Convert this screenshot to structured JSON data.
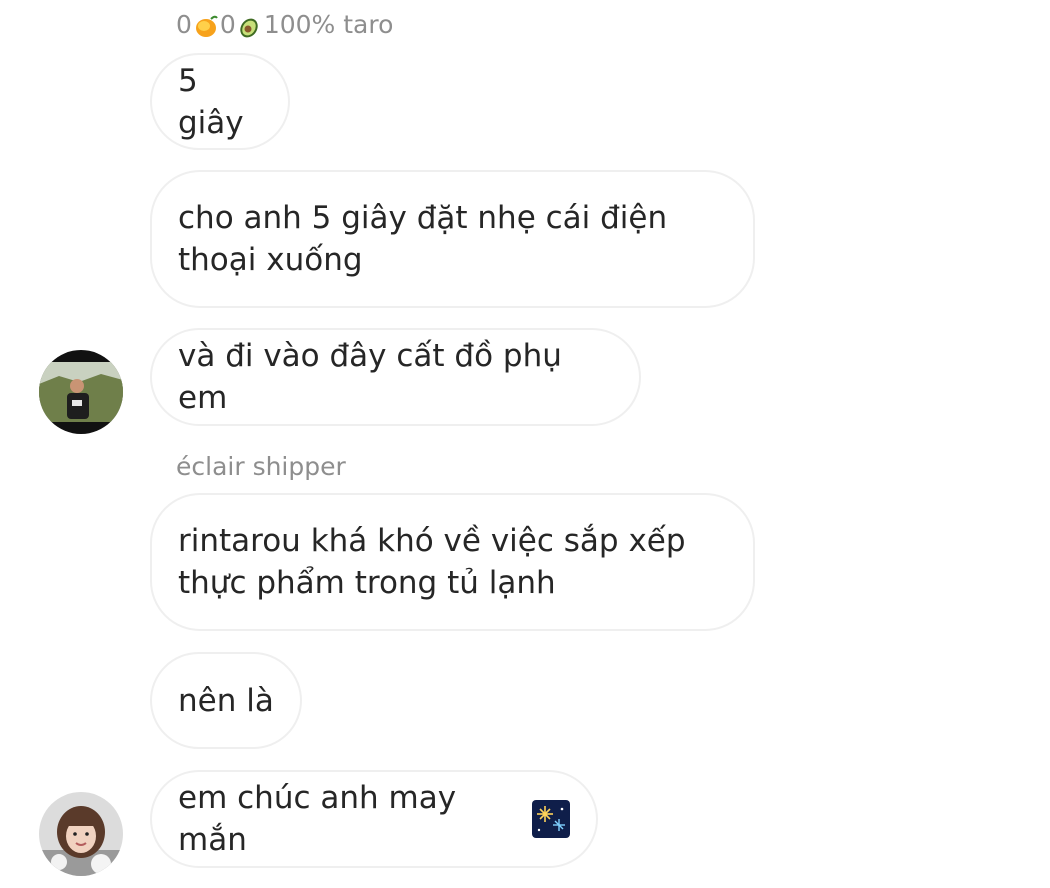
{
  "header": {
    "mango_count": "0",
    "avocado_count": "0",
    "status": "100% taro",
    "mango_icon": "mango-icon",
    "avocado_icon": "avocado-icon"
  },
  "messages": [
    {
      "text": "5 giây"
    },
    {
      "text": "cho anh 5 giây đặt nhẹ cái điện\nthoại xuống"
    },
    {
      "text": "và đi vào đây cất đồ phụ em"
    },
    {
      "sender": "éclair shipper"
    },
    {
      "text": "rintarou khá khó về việc sắp xếp\nthực phẩm trong tủ lạnh"
    },
    {
      "text": "nên là"
    },
    {
      "text": "em chúc anh may mắn",
      "emoji": "fireworks-icon"
    }
  ],
  "colors": {
    "bubble_border": "#efefef",
    "label": "#8e8e8e",
    "text": "#262626"
  }
}
